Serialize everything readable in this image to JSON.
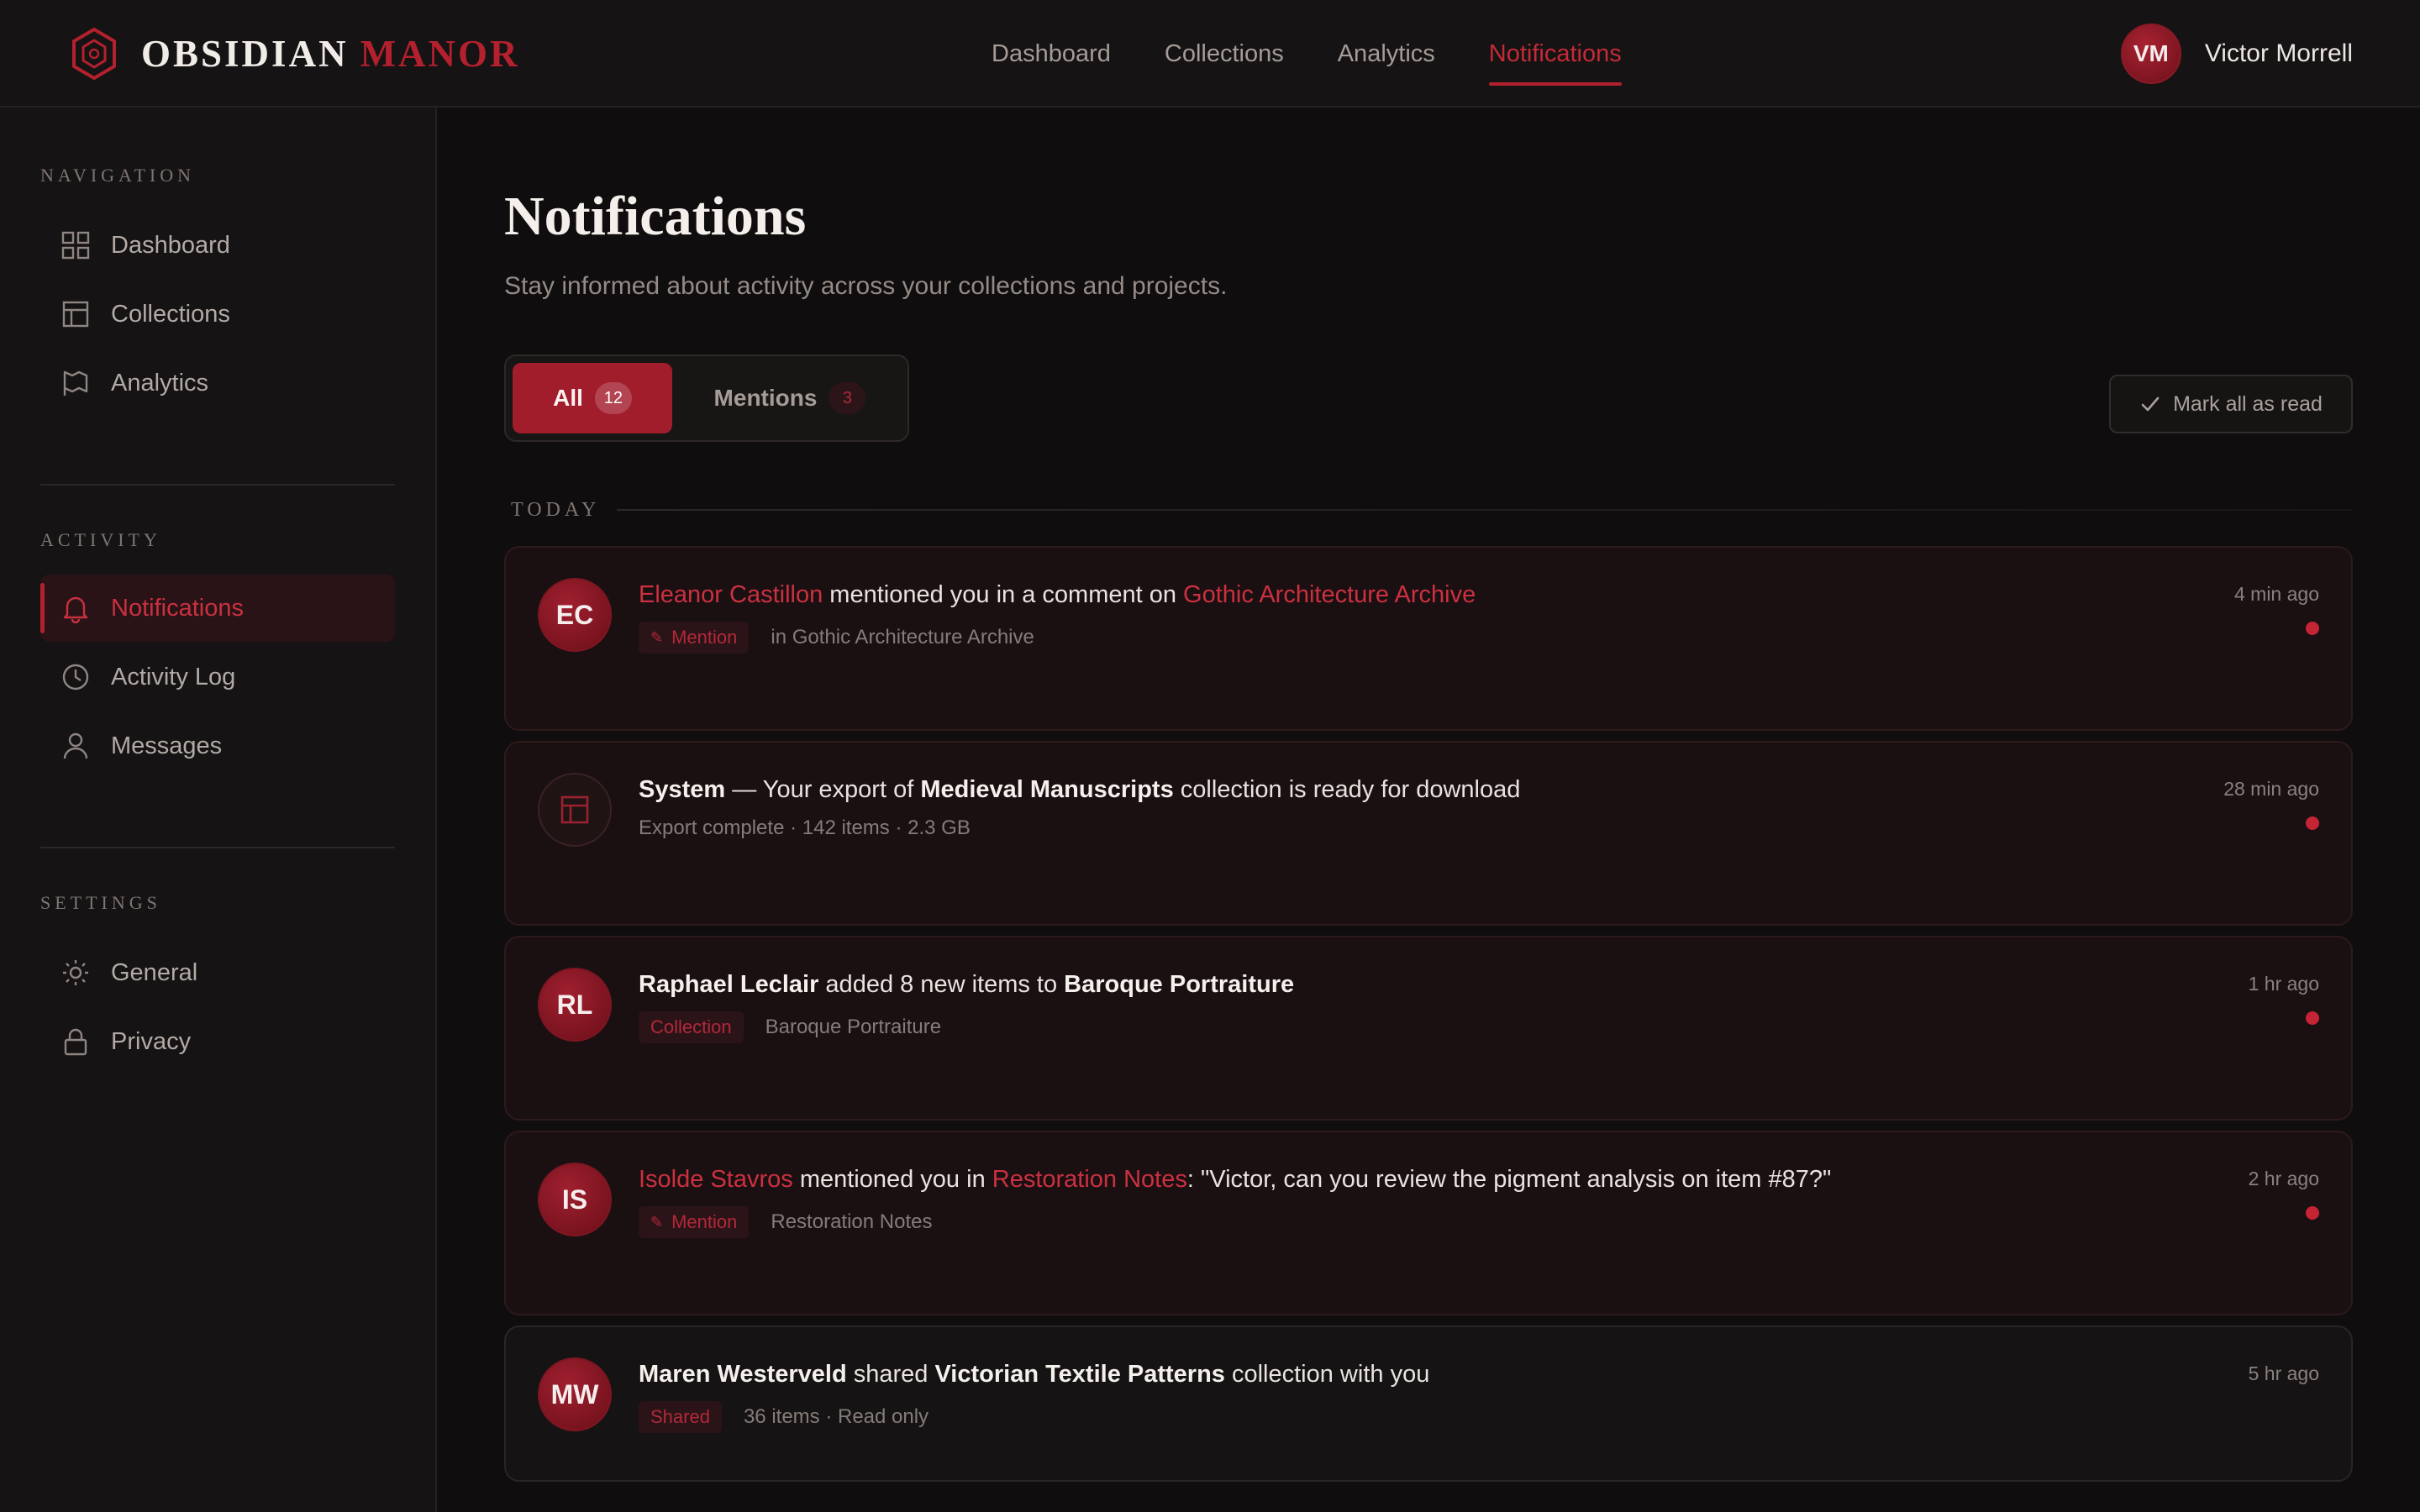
{
  "brand": {
    "name_primary": "OBSIDIAN",
    "name_accent": "MANOR",
    "icon": "hexagon-logo-icon"
  },
  "topnav": [
    {
      "label": "Dashboard",
      "active": false
    },
    {
      "label": "Collections",
      "active": false
    },
    {
      "label": "Analytics",
      "active": false
    },
    {
      "label": "Notifications",
      "active": true
    }
  ],
  "user": {
    "initials": "VM",
    "name": "Victor Morrell"
  },
  "sidebar": {
    "sections": [
      {
        "title": "NAVIGATION",
        "items": [
          {
            "label": "Dashboard",
            "icon": "grid-icon"
          },
          {
            "label": "Collections",
            "icon": "table-icon"
          },
          {
            "label": "Analytics",
            "icon": "flag-icon"
          }
        ]
      },
      {
        "title": "ACTIVITY",
        "items": [
          {
            "label": "Notifications",
            "icon": "bell-icon",
            "active": true
          },
          {
            "label": "Activity Log",
            "icon": "clock-icon"
          },
          {
            "label": "Messages",
            "icon": "user-icon"
          }
        ]
      },
      {
        "title": "SETTINGS",
        "items": [
          {
            "label": "General",
            "icon": "sun-icon"
          },
          {
            "label": "Privacy",
            "icon": "lock-icon"
          }
        ]
      }
    ]
  },
  "page": {
    "title": "Notifications",
    "subtitle": "Stay informed about activity across your collections and projects."
  },
  "tabs": [
    {
      "label": "All",
      "count": "12",
      "active": true
    },
    {
      "label": "Mentions",
      "count": "3",
      "active": false
    }
  ],
  "mark_all_read": "Mark all as read",
  "day_label": "TODAY",
  "notifications": [
    {
      "initials": "EC",
      "actor": "Eleanor Castillon",
      "text_1": " mentioned you in a comment on ",
      "target": "Gothic Architecture Archive",
      "tag": "Mention",
      "meta": "in Gothic Architecture Archive",
      "time": "4 min ago",
      "unread": true
    },
    {
      "initials": "",
      "actor": "System",
      "text_1": " — Your export of ",
      "target": "Medieval Manuscripts",
      "text_2": " collection is ready for download",
      "meta": "Export complete · 142 items · 2.3 GB",
      "time": "28 min ago",
      "unread": true
    },
    {
      "initials": "RL",
      "actor": "Raphael Leclair",
      "text_1": " added 8 new items to ",
      "target": "Baroque Portraiture",
      "tag": "Collection",
      "meta": "Baroque Portraiture",
      "time": "1 hr ago",
      "unread": true
    },
    {
      "initials": "IS",
      "actor": "Isolde Stavros",
      "text_1": " mentioned you in ",
      "target": "Restoration Notes",
      "text_2": ": \"Victor, can you review the pigment analysis on item #87?\"",
      "tag": "Mention",
      "meta": "Restoration Notes",
      "time": "2 hr ago",
      "unread": true
    },
    {
      "initials": "MW",
      "actor": "Maren Westerveld",
      "text_1": " shared ",
      "target": "Victorian Textile Patterns",
      "text_2": " collection with you",
      "tag": "Shared",
      "meta": "36 items · Read only",
      "time": "5 hr ago",
      "unread": false
    }
  ],
  "colors": {
    "accent": "#b3202e",
    "background": "#0f0d0d",
    "panel": "#151313"
  }
}
